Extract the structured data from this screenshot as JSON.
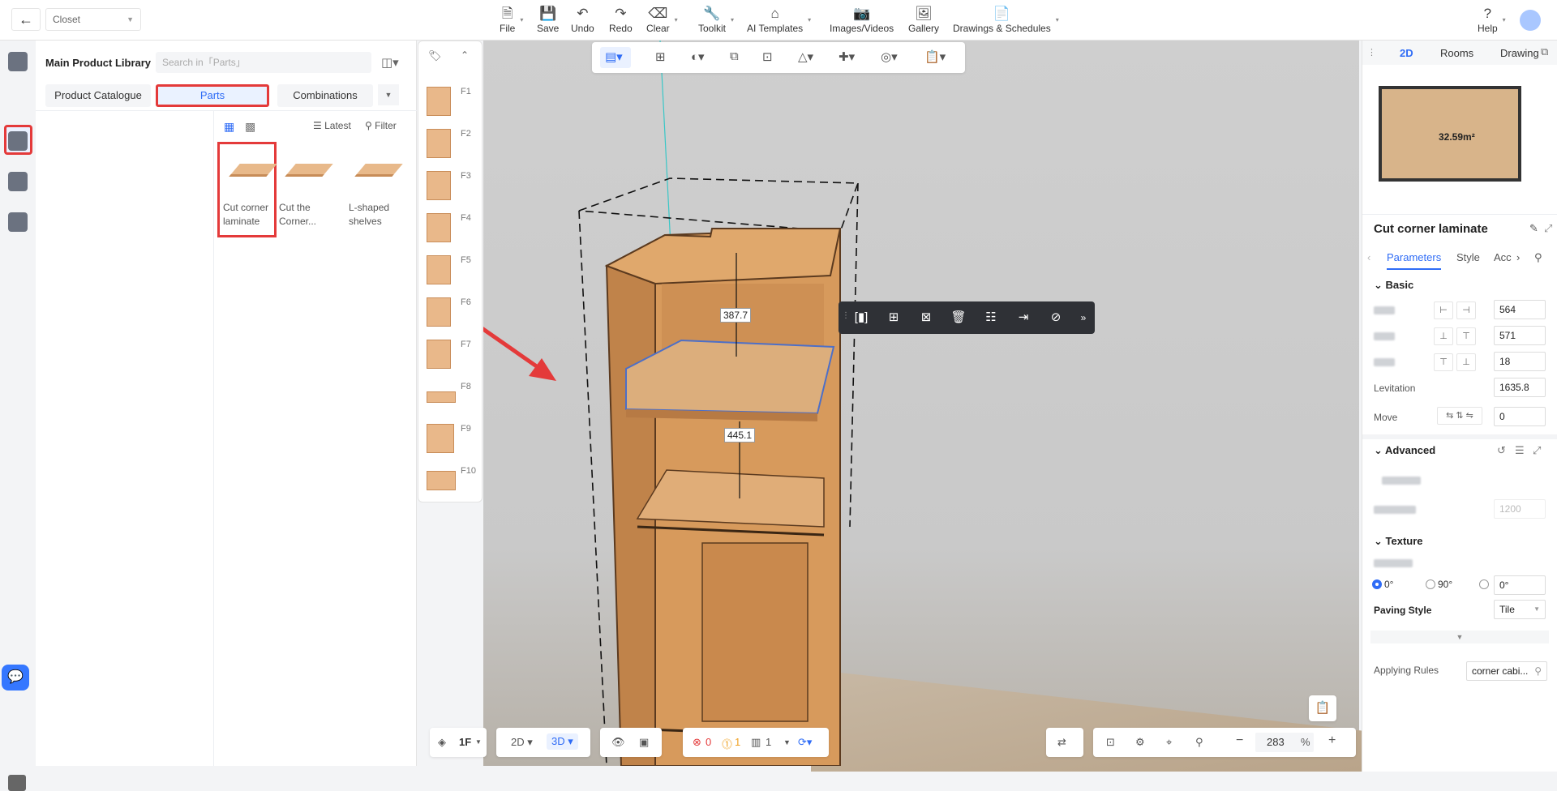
{
  "topbar": {
    "project": "Closet",
    "tools": [
      {
        "label": "File",
        "icon": "file-icon",
        "glyph": "🗎"
      },
      {
        "label": "Save",
        "icon": "save-icon",
        "glyph": "💾"
      },
      {
        "label": "Undo",
        "icon": "undo-icon",
        "glyph": "↶"
      },
      {
        "label": "Redo",
        "icon": "redo-icon",
        "glyph": "↷"
      },
      {
        "label": "Clear",
        "icon": "clear-icon",
        "glyph": "⌫"
      },
      {
        "label": "Toolkit",
        "icon": "toolkit-icon",
        "glyph": "🔧"
      },
      {
        "label": "AI Templates",
        "icon": "ai-templates-icon",
        "glyph": "⌂"
      },
      {
        "label": "Images/Videos",
        "icon": "camera-icon",
        "glyph": "📷"
      },
      {
        "label": "Gallery",
        "icon": "gallery-icon",
        "glyph": "🖼"
      },
      {
        "label": "Drawings & Schedules",
        "icon": "drawings-icon",
        "glyph": "📄"
      }
    ],
    "help": "Help"
  },
  "library": {
    "title": "Main Product Library",
    "search_placeholder": "Search in「Parts」",
    "tabs": [
      "Product Catalogue",
      "Parts",
      "Combinations"
    ],
    "sort": "Latest",
    "filter": "Filter",
    "products": [
      {
        "line1": "Cut corner",
        "line2": "laminate"
      },
      {
        "line1": "Cut the",
        "line2": "Corner..."
      },
      {
        "line1": "L-shaped",
        "line2": "shelves"
      }
    ]
  },
  "fstrip": [
    "F1",
    "F2",
    "F3",
    "F4",
    "F5",
    "F6",
    "F7",
    "F8",
    "F9",
    "F10"
  ],
  "viewport": {
    "dim_upper": "387.7",
    "dim_lower": "445.1"
  },
  "right_panel": {
    "view_tabs": [
      "2D",
      "Rooms",
      "Drawing"
    ],
    "area": "32.59m²",
    "title": "Cut corner laminate",
    "tabs": [
      "Parameters",
      "Style",
      "Acc"
    ],
    "basic": "Basic",
    "width": "564",
    "depth": "571",
    "height": "18",
    "levitation_label": "Levitation",
    "levitation": "1635.8",
    "move_label": "Move",
    "move": "0",
    "advanced": "Advanced",
    "adv_value": "1200",
    "texture": "Texture",
    "rot_options": [
      "0°",
      "90°",
      "0°"
    ],
    "paving_label": "Paving Style",
    "paving": "Tile",
    "rules_label": "Applying Rules",
    "rules": "corner cabi..."
  },
  "bottombar": {
    "floor": "1F",
    "mode2d": "2D",
    "mode3d": "3D",
    "errors": "0",
    "warnings": "1",
    "count": "1",
    "zoom": "283",
    "zoom_unit": "%"
  }
}
